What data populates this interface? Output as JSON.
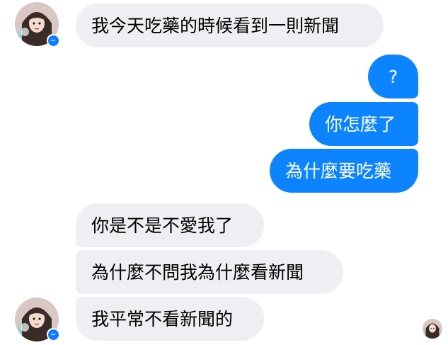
{
  "messages": [
    {
      "id": "b1",
      "sender": "them",
      "text": "我今天吃藥的時候看到一則新聞"
    },
    {
      "id": "b2",
      "sender": "me",
      "text": "?"
    },
    {
      "id": "b3",
      "sender": "me",
      "text": "你怎麼了"
    },
    {
      "id": "b4",
      "sender": "me",
      "text": "為什麼要吃藥"
    },
    {
      "id": "b5",
      "sender": "them",
      "text": "你是不是不愛我了"
    },
    {
      "id": "b6",
      "sender": "them",
      "text": "為什麼不問我為什麼看新聞"
    },
    {
      "id": "b7",
      "sender": "them",
      "text": "我平常不看新聞的"
    }
  ],
  "icons": {
    "contact_avatar": "contact-avatar-icon",
    "messenger_badge": "messenger-badge-icon",
    "seen_avatar": "seen-receipt-avatar-icon"
  },
  "colors": {
    "incoming_bubble": "#eeeff2",
    "outgoing_bubble": "#0c84ff",
    "messenger_blue": "#0a7cff"
  }
}
